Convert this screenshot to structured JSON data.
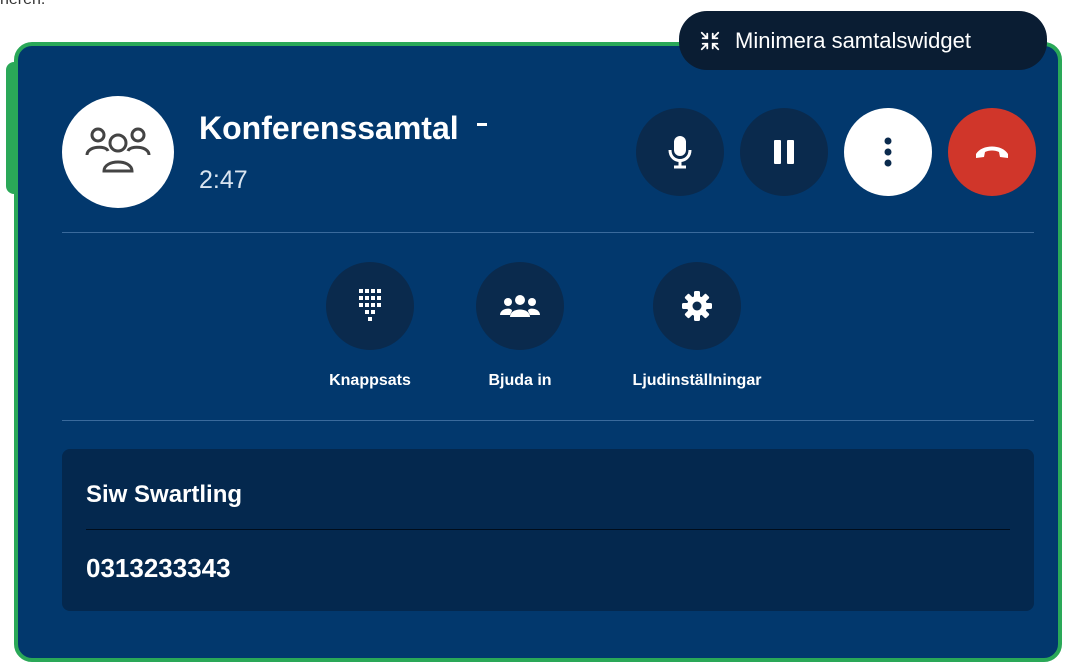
{
  "top_fragment": "nereh.",
  "tooltip": {
    "icon": "minimize-icon",
    "label": "Minimera samtalswidget"
  },
  "call": {
    "avatar_icon": "group-icon",
    "title": "Konferenssamtal",
    "duration": "2:47"
  },
  "controls": [
    {
      "name": "mute",
      "icon": "microphone-icon"
    },
    {
      "name": "hold",
      "icon": "pause-icon"
    },
    {
      "name": "more",
      "icon": "more-vertical-icon"
    },
    {
      "name": "hang-up",
      "icon": "hang-up-icon"
    }
  ],
  "actions": [
    {
      "label": "Knappsats",
      "icon": "keypad-icon"
    },
    {
      "label": "Bjuda in",
      "icon": "people-icon"
    },
    {
      "label": "Ljudinställningar",
      "icon": "gear-icon"
    }
  ],
  "participant": {
    "name": "Siw Swartling",
    "number": "0313233343"
  },
  "colors": {
    "panel": "#02386d",
    "border": "#2aa858",
    "button_dark": "#0a2a4d",
    "hangup": "#d0362a",
    "tooltip": "#0a1d33"
  }
}
